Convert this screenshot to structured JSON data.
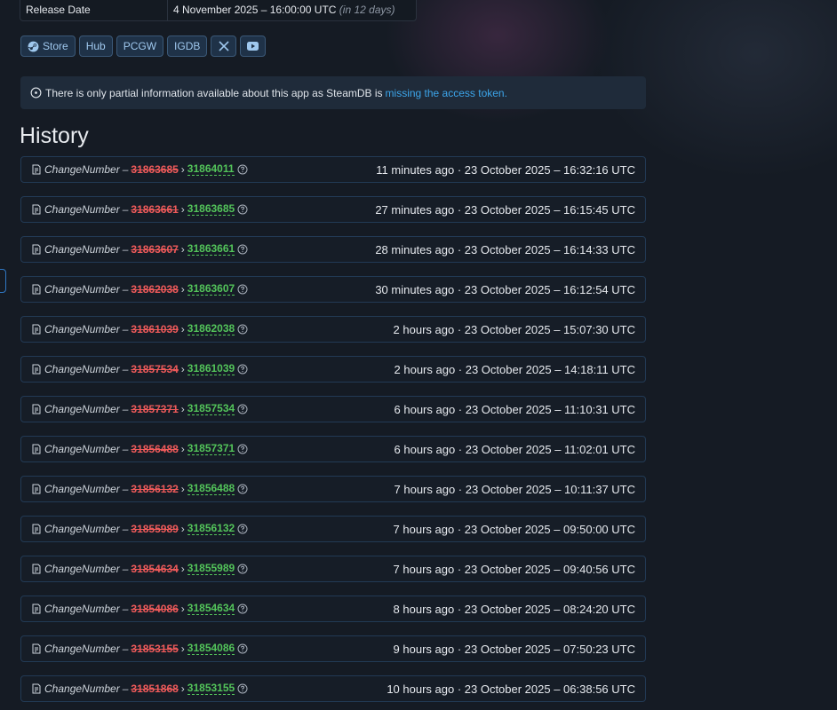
{
  "info": {
    "release_label": "Release Date",
    "release_value": "4 November 2025 – 16:00:00 UTC",
    "release_relative": "(in 12 days)"
  },
  "links": [
    {
      "label": "Store",
      "icon": "steam-icon"
    },
    {
      "label": "Hub",
      "icon": ""
    },
    {
      "label": "PCGW",
      "icon": ""
    },
    {
      "label": "IGDB",
      "icon": ""
    },
    {
      "label": "",
      "icon": "x-icon"
    },
    {
      "label": "",
      "icon": "youtube-icon"
    }
  ],
  "notice": {
    "text": "There is only partial information available about this app as SteamDB is",
    "link": "missing the access token."
  },
  "history": {
    "title": "History",
    "field": "ChangeNumber",
    "dash": "–",
    "arrow": "›",
    "rows": [
      {
        "old": "31863685",
        "new": "31864011",
        "time": "11 minutes ago · 23 October 2025 – 16:32:16 UTC"
      },
      {
        "old": "31863661",
        "new": "31863685",
        "time": "27 minutes ago · 23 October 2025 – 16:15:45 UTC"
      },
      {
        "old": "31863607",
        "new": "31863661",
        "time": "28 minutes ago · 23 October 2025 – 16:14:33 UTC"
      },
      {
        "old": "31862038",
        "new": "31863607",
        "time": "30 minutes ago · 23 October 2025 – 16:12:54 UTC"
      },
      {
        "old": "31861039",
        "new": "31862038",
        "time": "2 hours ago · 23 October 2025 – 15:07:30 UTC"
      },
      {
        "old": "31857534",
        "new": "31861039",
        "time": "2 hours ago · 23 October 2025 – 14:18:11 UTC"
      },
      {
        "old": "31857371",
        "new": "31857534",
        "time": "6 hours ago · 23 October 2025 – 11:10:31 UTC"
      },
      {
        "old": "31856488",
        "new": "31857371",
        "time": "6 hours ago · 23 October 2025 – 11:02:01 UTC"
      },
      {
        "old": "31856132",
        "new": "31856488",
        "time": "7 hours ago · 23 October 2025 – 10:11:37 UTC"
      },
      {
        "old": "31855989",
        "new": "31856132",
        "time": "7 hours ago · 23 October 2025 – 09:50:00 UTC"
      },
      {
        "old": "31854634",
        "new": "31855989",
        "time": "7 hours ago · 23 October 2025 – 09:40:56 UTC"
      },
      {
        "old": "31854086",
        "new": "31854634",
        "time": "8 hours ago · 23 October 2025 – 08:24:20 UTC"
      },
      {
        "old": "31853155",
        "new": "31854086",
        "time": "9 hours ago · 23 October 2025 – 07:50:23 UTC"
      },
      {
        "old": "31851868",
        "new": "31853155",
        "time": "10 hours ago · 23 October 2025 – 06:38:56 UTC"
      }
    ]
  },
  "colors": {
    "background": "#151b24",
    "removed": "#ee5a5a",
    "added": "#53c45a",
    "link": "#3ca5ea"
  }
}
